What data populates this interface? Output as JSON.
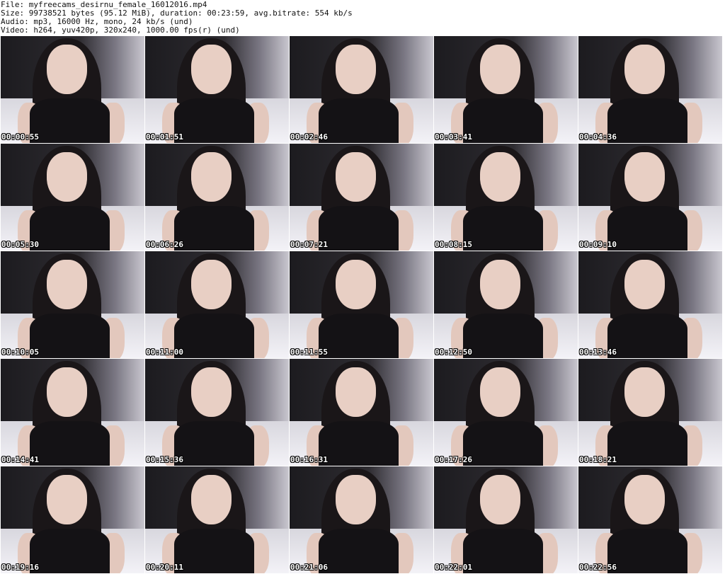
{
  "header": {
    "file": "File: myfreecams_desirnu_female_16012016.mp4",
    "size": "Size: 99738521 bytes (95.12 MiB), duration: 00:23:59, avg.bitrate: 554 kb/s",
    "audio": "Audio: mp3, 16000 Hz, mono, 24 kb/s (und)",
    "video": "Video: h264, yuv420p, 320x240, 1000.00 fps(r) (und)"
  },
  "thumbnails": [
    {
      "time": "00:00:55"
    },
    {
      "time": "00:01:51"
    },
    {
      "time": "00:02:46"
    },
    {
      "time": "00:03:41"
    },
    {
      "time": "00:04:36"
    },
    {
      "time": "00:05:30"
    },
    {
      "time": "00:06:26"
    },
    {
      "time": "00:07:21"
    },
    {
      "time": "00:08:15"
    },
    {
      "time": "00:09:10"
    },
    {
      "time": "00:10:05"
    },
    {
      "time": "00:11:00"
    },
    {
      "time": "00:11:55"
    },
    {
      "time": "00:12:50"
    },
    {
      "time": "00:13:46"
    },
    {
      "time": "00:14:41"
    },
    {
      "time": "00:15:36"
    },
    {
      "time": "00:16:31"
    },
    {
      "time": "00:17:26"
    },
    {
      "time": "00:18:21"
    },
    {
      "time": "00:19:16"
    },
    {
      "time": "00:20:11"
    },
    {
      "time": "00:21:06"
    },
    {
      "time": "00:22:01"
    },
    {
      "time": "00:22:56"
    }
  ]
}
